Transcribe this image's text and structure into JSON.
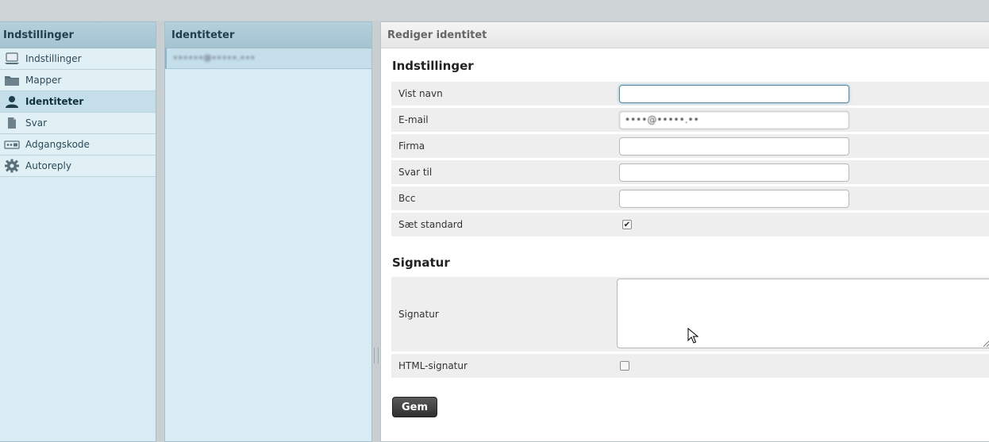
{
  "settings_panel": {
    "title": "Indstillinger",
    "items": [
      {
        "label": "Indstillinger",
        "icon": "laptop-icon"
      },
      {
        "label": "Mapper",
        "icon": "folder-icon"
      },
      {
        "label": "Identiteter",
        "icon": "user-icon",
        "selected": true
      },
      {
        "label": "Svar",
        "icon": "document-icon"
      },
      {
        "label": "Adgangskode",
        "icon": "password-icon"
      },
      {
        "label": "Autoreply",
        "icon": "gear-icon"
      }
    ]
  },
  "identities_panel": {
    "title": "Identiteter",
    "items": [
      {
        "label": "••••••@•••••.•••"
      }
    ]
  },
  "edit_panel": {
    "title": "Rediger identitet",
    "settings_section": {
      "title": "Indstillinger",
      "fields": {
        "display_name": {
          "label": "Vist navn",
          "value": ""
        },
        "email": {
          "label": "E-mail",
          "value": "••••@•••••.••"
        },
        "company": {
          "label": "Firma",
          "value": ""
        },
        "reply_to": {
          "label": "Svar til",
          "value": ""
        },
        "bcc": {
          "label": "Bcc",
          "value": ""
        },
        "set_default": {
          "label": "Sæt standard",
          "checked": true
        }
      }
    },
    "signature_section": {
      "title": "Signatur",
      "signature_label": "Signatur",
      "signature_value": "",
      "html_signature_label": "HTML-signatur",
      "html_signature_checked": false
    },
    "save_button": "Gem"
  },
  "colors": {
    "panel_bg": "#d9ecf3",
    "header_bg": "#a4c4d2",
    "selected_bg": "#c5dfea",
    "button_bg": "#2f2f2f"
  }
}
